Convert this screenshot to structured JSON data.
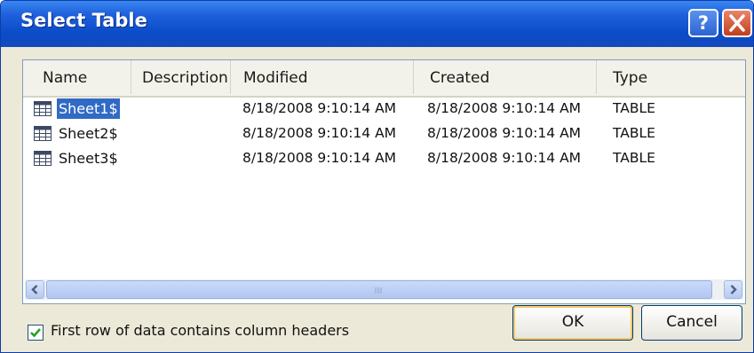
{
  "window": {
    "title": "Select Table"
  },
  "title_buttons": {
    "help_glyph": "?",
    "close_glyph": "✕"
  },
  "columns": [
    "Name",
    "Description",
    "Modified",
    "Created",
    "Type"
  ],
  "rows": [
    {
      "name": "Sheet1$",
      "description": "",
      "modified": "8/18/2008 9:10:14 AM",
      "created": "8/18/2008 9:10:14 AM",
      "type": "TABLE",
      "selected": true
    },
    {
      "name": "Sheet2$",
      "description": "",
      "modified": "8/18/2008 9:10:14 AM",
      "created": "8/18/2008 9:10:14 AM",
      "type": "TABLE",
      "selected": false
    },
    {
      "name": "Sheet3$",
      "description": "",
      "modified": "8/18/2008 9:10:14 AM",
      "created": "8/18/2008 9:10:14 AM",
      "type": "TABLE",
      "selected": false
    }
  ],
  "row_icon": "table-grid-icon",
  "options": {
    "first_row_headers_label": "First row of data contains column headers",
    "first_row_headers_checked": true
  },
  "buttons": {
    "ok": "OK",
    "cancel": "Cancel"
  },
  "colors": {
    "titlebar": "#0a4cc8",
    "selection": "#316ac5",
    "dialog_bg": "#ece9d8"
  }
}
